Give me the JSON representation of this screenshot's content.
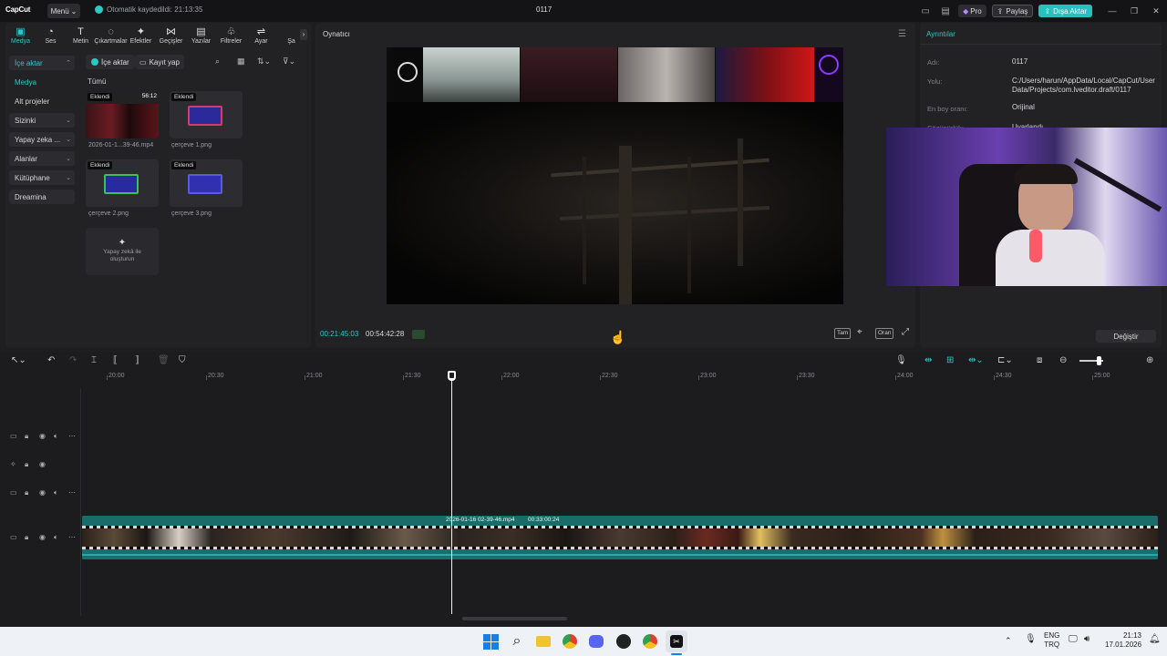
{
  "app": {
    "logo": "CapCut",
    "menu_label": "Menü",
    "autosave_text": "Otomatik kaydedildi: 21:13:35",
    "project_title": "0117",
    "pro_label": "Pro",
    "share_label": "Paylaş",
    "export_label": "Dışa Aktar"
  },
  "tool_tabs": [
    {
      "label": "Medya",
      "icon": "▣"
    },
    {
      "label": "Ses",
      "icon": "◔"
    },
    {
      "label": "Metin",
      "icon": "T"
    },
    {
      "label": "Çıkartmalar",
      "icon": "◌"
    },
    {
      "label": "Efektler",
      "icon": "✦"
    },
    {
      "label": "Geçişler",
      "icon": "⋈"
    },
    {
      "label": "Yazılar",
      "icon": "▤"
    },
    {
      "label": "Filtreler",
      "icon": "♧"
    },
    {
      "label": "Ayar",
      "icon": "⇌"
    },
    {
      "label": "Şa",
      "icon": ""
    }
  ],
  "side_nav": [
    {
      "label": "İçe aktar",
      "chevron": "⌃"
    },
    {
      "label": "Medya",
      "chevron": ""
    },
    {
      "label": "Alt projeler",
      "chevron": ""
    },
    {
      "label": "Sizinki",
      "chevron": "⌄"
    },
    {
      "label": "Yapay zeka ...",
      "chevron": "⌄"
    },
    {
      "label": "Alanlar",
      "chevron": "⌄"
    },
    {
      "label": "Kütüphane",
      "chevron": "⌄"
    },
    {
      "label": "Dreamina",
      "chevron": ""
    }
  ],
  "media": {
    "import_label": "İçe aktar",
    "record_label": "Kayıt yap",
    "all_label": "Tümü",
    "badge": "Eklendi",
    "items": [
      {
        "name": "2026-01-1...39-46.mp4",
        "duration": "56:12"
      },
      {
        "name": "çerçeve 1.png",
        "duration": ""
      },
      {
        "name": "çerçeve 2.png",
        "duration": ""
      },
      {
        "name": "çerçeve 3.png",
        "duration": ""
      }
    ],
    "ai_create_label": "Yapay zekâ ile oluşturun"
  },
  "player": {
    "title": "Oynatıcı",
    "current_time": "00:21:45:03",
    "total_time": "00:54:42:28",
    "full_label": "Tam",
    "ratio_label": "Oran"
  },
  "details": {
    "title": "Ayrıntılar",
    "fields": [
      {
        "label": "Adı:",
        "value": "0117"
      },
      {
        "label": "Yolu:",
        "value": "C:/Users/harun/AppData/Local/CapCut/User Data/Projects/com.lveditor.draft/0117"
      },
      {
        "label": "En boy oranı:",
        "value": "Orijinal"
      },
      {
        "label": "Çözünürlük:",
        "value": "Uyarlandı"
      }
    ],
    "change_label": "Değiştir"
  },
  "timeline": {
    "ruler_labels": [
      "20:00",
      "20:30",
      "21:00",
      "21:30",
      "22:00",
      "22:30",
      "23:00",
      "23:30",
      "24:00",
      "24:30",
      "25:00"
    ],
    "clip_name": "2026-01-16 02-39-46.mp4",
    "clip_duration": "00:33:00:24"
  },
  "taskbar": {
    "lang_line1": "ENG",
    "lang_line2": "TRQ",
    "time": "21:13",
    "date": "17.01.2026"
  },
  "colors": {
    "accent": "#2dc7c3",
    "clip": "#1a6c6a"
  }
}
